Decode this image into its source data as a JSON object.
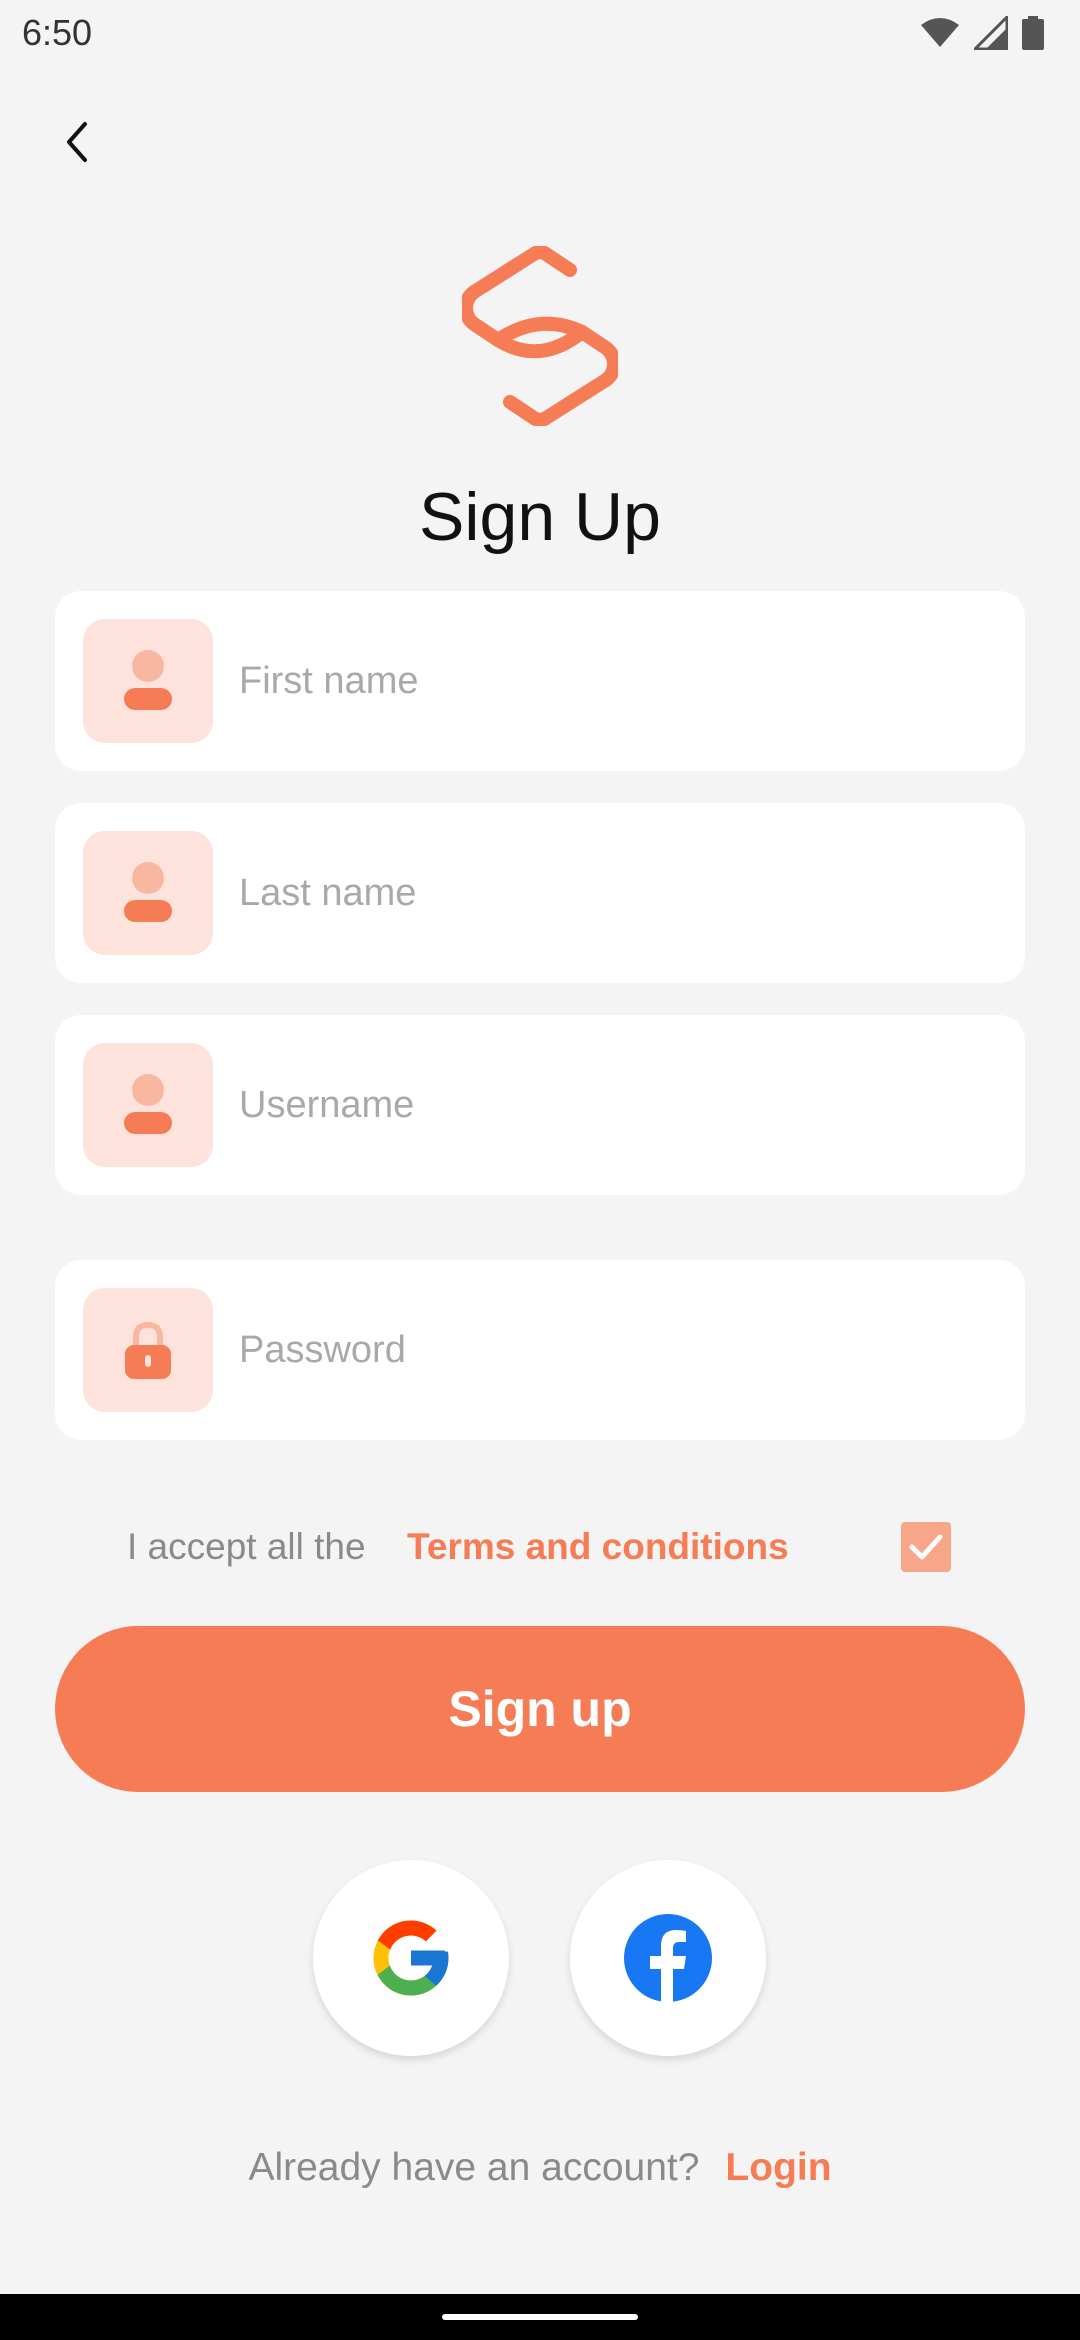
{
  "status_bar": {
    "time": "6:50",
    "icons": [
      "wifi-icon",
      "signal-icon",
      "battery-icon"
    ]
  },
  "colors": {
    "accent": "#f67c56",
    "accent_light": "#fde3db",
    "background": "#f4f4f4",
    "field_bg": "#ffffff"
  },
  "header": {
    "back_icon": "chevron-left-icon",
    "logo_icon": "app-logo-icon",
    "title": "Sign Up"
  },
  "form": {
    "first_name": {
      "placeholder": "First name",
      "value": "",
      "icon": "user-icon"
    },
    "last_name": {
      "placeholder": "Last name",
      "value": "",
      "icon": "user-icon"
    },
    "username": {
      "placeholder": "Username",
      "value": "",
      "icon": "user-icon"
    },
    "password": {
      "placeholder": "Password",
      "value": "",
      "icon": "lock-icon"
    }
  },
  "terms": {
    "prefix": "I accept all the",
    "link": "Terms and conditions",
    "checked": true
  },
  "signup_button": {
    "label": "Sign up"
  },
  "social": [
    {
      "name": "Google",
      "icon": "google-icon"
    },
    {
      "name": "Facebook",
      "icon": "facebook-icon"
    }
  ],
  "login": {
    "prompt": "Already have an account?",
    "link": "Login"
  }
}
